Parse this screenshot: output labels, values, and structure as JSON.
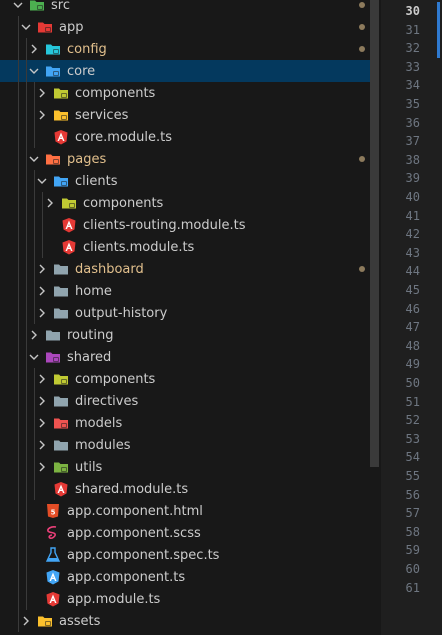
{
  "tree": [
    {
      "label": "src",
      "depth": 0,
      "chevron": "down",
      "icon": "folder-src-open-icon",
      "color": "#4caf50",
      "modified": false,
      "dot": true
    },
    {
      "label": "app",
      "depth": 1,
      "chevron": "down",
      "icon": "folder-app-open-icon",
      "color": "#e53935",
      "modified": false,
      "dot": true
    },
    {
      "label": "config",
      "depth": 2,
      "chevron": "right",
      "icon": "folder-config-icon",
      "color": "#26c6da",
      "modified": true,
      "dot": true
    },
    {
      "label": "core",
      "depth": 2,
      "chevron": "down",
      "icon": "folder-core-open-icon",
      "color": "#42a5f5",
      "modified": false,
      "dot": false,
      "selected": true
    },
    {
      "label": "components",
      "depth": 3,
      "chevron": "right",
      "icon": "folder-components-icon",
      "color": "#c0ca33",
      "modified": false,
      "dot": false
    },
    {
      "label": "services",
      "depth": 3,
      "chevron": "right",
      "icon": "folder-services-icon",
      "color": "#fbc02d",
      "modified": false,
      "dot": false
    },
    {
      "label": "core.module.ts",
      "depth": 3,
      "chevron": "none",
      "icon": "angular-file-icon",
      "color": "#e53935",
      "modified": false,
      "dot": false
    },
    {
      "label": "pages",
      "depth": 2,
      "chevron": "down",
      "icon": "folder-pages-open-icon",
      "color": "#ff7043",
      "modified": true,
      "dot": true
    },
    {
      "label": "clients",
      "depth": 3,
      "chevron": "down",
      "icon": "folder-clients-open-icon",
      "color": "#42a5f5",
      "modified": false,
      "dot": false
    },
    {
      "label": "components",
      "depth": 4,
      "chevron": "right",
      "icon": "folder-components-icon",
      "color": "#c0ca33",
      "modified": false,
      "dot": false
    },
    {
      "label": "clients-routing.module.ts",
      "depth": 4,
      "chevron": "none",
      "icon": "angular-file-icon",
      "color": "#e53935",
      "modified": false,
      "dot": false
    },
    {
      "label": "clients.module.ts",
      "depth": 4,
      "chevron": "none",
      "icon": "angular-file-icon",
      "color": "#e53935",
      "modified": false,
      "dot": false
    },
    {
      "label": "dashboard",
      "depth": 3,
      "chevron": "right",
      "icon": "folder-icon",
      "color": "#90a4ae",
      "modified": true,
      "dot": true
    },
    {
      "label": "home",
      "depth": 3,
      "chevron": "right",
      "icon": "folder-icon",
      "color": "#90a4ae",
      "modified": false,
      "dot": false
    },
    {
      "label": "output-history",
      "depth": 3,
      "chevron": "right",
      "icon": "folder-icon",
      "color": "#90a4ae",
      "modified": false,
      "dot": false
    },
    {
      "label": "routing",
      "depth": 2,
      "chevron": "right",
      "icon": "folder-icon",
      "color": "#90a4ae",
      "modified": false,
      "dot": false
    },
    {
      "label": "shared",
      "depth": 2,
      "chevron": "down",
      "icon": "folder-shared-open-icon",
      "color": "#ab47bc",
      "modified": false,
      "dot": false
    },
    {
      "label": "components",
      "depth": 3,
      "chevron": "right",
      "icon": "folder-components-icon",
      "color": "#c0ca33",
      "modified": false,
      "dot": false
    },
    {
      "label": "directives",
      "depth": 3,
      "chevron": "right",
      "icon": "folder-icon",
      "color": "#90a4ae",
      "modified": false,
      "dot": false
    },
    {
      "label": "models",
      "depth": 3,
      "chevron": "right",
      "icon": "folder-models-icon",
      "color": "#ef5350",
      "modified": false,
      "dot": false
    },
    {
      "label": "modules",
      "depth": 3,
      "chevron": "right",
      "icon": "folder-icon",
      "color": "#90a4ae",
      "modified": false,
      "dot": false
    },
    {
      "label": "utils",
      "depth": 3,
      "chevron": "right",
      "icon": "folder-utils-icon",
      "color": "#7cb342",
      "modified": false,
      "dot": false
    },
    {
      "label": "shared.module.ts",
      "depth": 3,
      "chevron": "none",
      "icon": "angular-file-icon",
      "color": "#e53935",
      "modified": false,
      "dot": false
    },
    {
      "label": "app.component.html",
      "depth": 2,
      "chevron": "none",
      "icon": "html5-file-icon",
      "color": "#e44d26",
      "modified": false,
      "dot": false
    },
    {
      "label": "app.component.scss",
      "depth": 2,
      "chevron": "none",
      "icon": "sass-file-icon",
      "color": "#ec407a",
      "modified": false,
      "dot": false
    },
    {
      "label": "app.component.spec.ts",
      "depth": 2,
      "chevron": "none",
      "icon": "test-flask-icon",
      "color": "#42a5f5",
      "modified": false,
      "dot": false
    },
    {
      "label": "app.component.ts",
      "depth": 2,
      "chevron": "none",
      "icon": "angular-component-icon",
      "color": "#42a5f5",
      "modified": false,
      "dot": false
    },
    {
      "label": "app.module.ts",
      "depth": 2,
      "chevron": "none",
      "icon": "angular-file-icon",
      "color": "#e53935",
      "modified": false,
      "dot": false
    },
    {
      "label": "assets",
      "depth": 1,
      "chevron": "right",
      "icon": "folder-assets-icon",
      "color": "#fbc02d",
      "modified": false,
      "dot": false
    }
  ],
  "line_numbers": [
    "30",
    "31",
    "32",
    "33",
    "34",
    "35",
    "36",
    "37",
    "38",
    "39",
    "40",
    "41",
    "42",
    "43",
    "44",
    "45",
    "46",
    "47",
    "48",
    "49",
    "50",
    "51",
    "52",
    "53",
    "54",
    "55",
    "56",
    "57",
    "58",
    "59",
    "60",
    "61"
  ],
  "active_line": "30",
  "colors": {
    "background": "#181818",
    "selection": "#04395e",
    "modified_text": "#e2c08d",
    "gutter_accent": "#2f7ad0"
  }
}
